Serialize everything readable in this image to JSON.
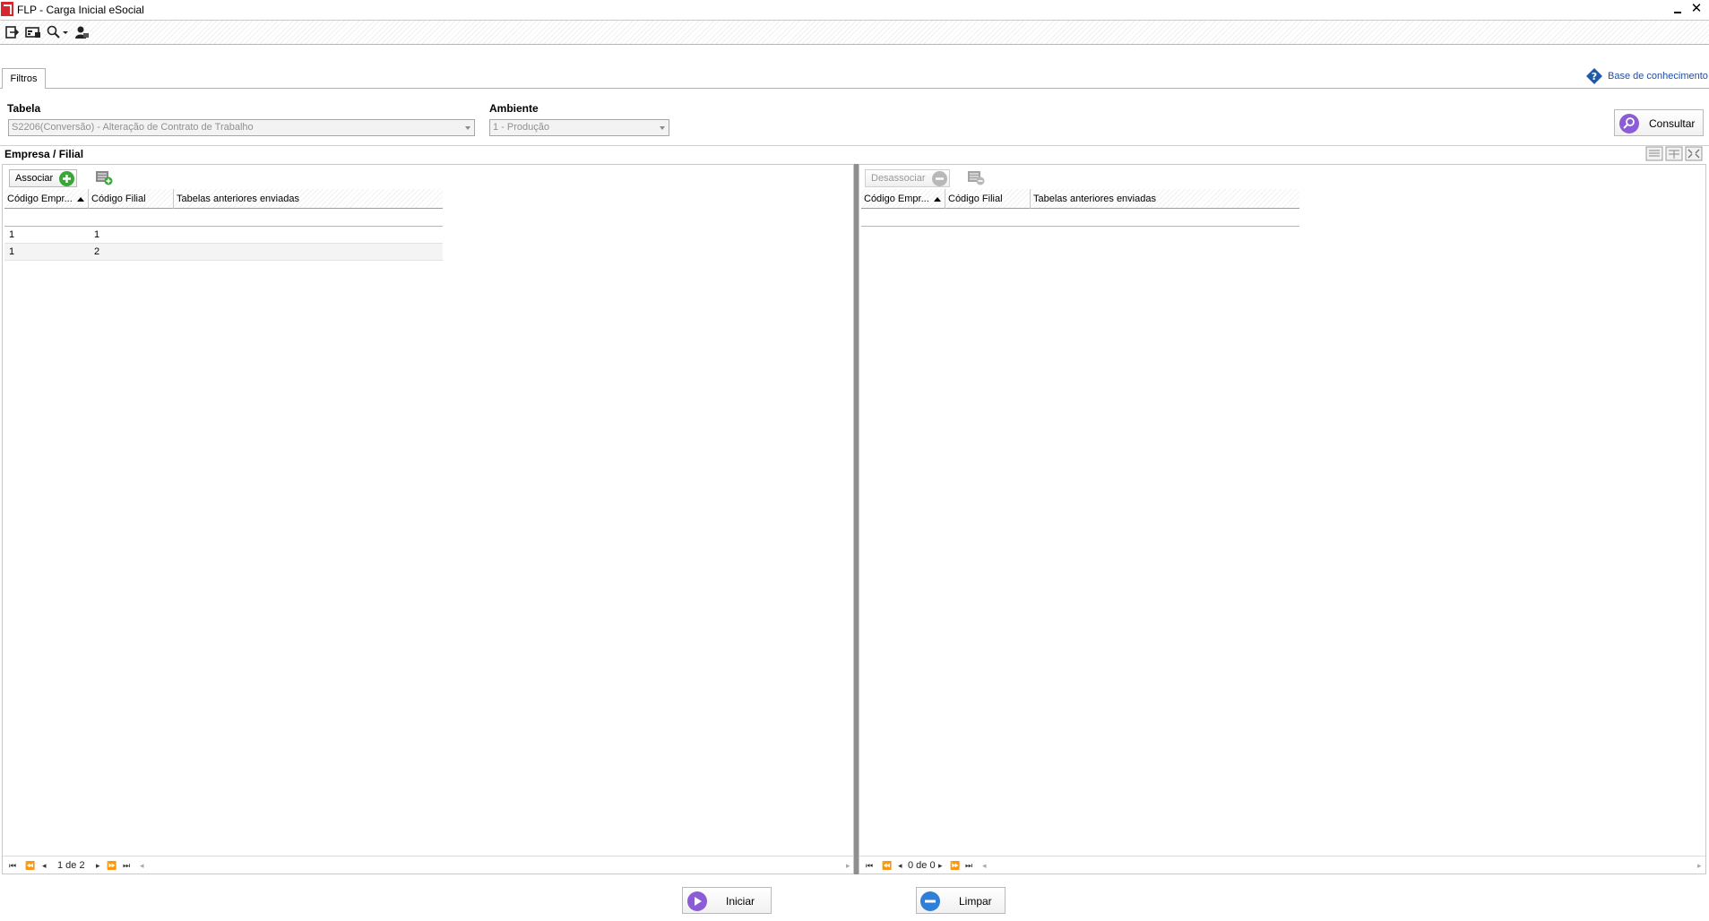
{
  "window": {
    "title": "FLP - Carga Inicial eSocial"
  },
  "toolbar": {
    "icons": [
      "exit-icon",
      "card-icon",
      "search-icon",
      "user-icon"
    ]
  },
  "tabs": [
    {
      "label": "Filtros"
    }
  ],
  "knowledge_base": {
    "label": "Base de conhecimento"
  },
  "filters": {
    "tabela_label": "Tabela",
    "tabela_value": "S2206(Conversão) - Alteração de Contrato de Trabalho",
    "ambiente_label": "Ambiente",
    "ambiente_value": "1 - Produção",
    "consultar_label": "Consultar"
  },
  "group": {
    "title": "Empresa / Filial"
  },
  "left_panel": {
    "action_label": "Associar",
    "columns": [
      "Código Empr...",
      "Código Filial",
      "Tabelas anteriores enviadas"
    ],
    "rows": [
      {
        "empresa": "1",
        "filial": "1",
        "tabelas": ""
      },
      {
        "empresa": "1",
        "filial": "2",
        "tabelas": ""
      }
    ],
    "pager_text": "1 de 2"
  },
  "right_panel": {
    "action_label": "Desassociar",
    "columns": [
      "Código Empr...",
      "Código Filial",
      "Tabelas anteriores enviadas"
    ],
    "rows": [],
    "pager_text": "0 de 0"
  },
  "footer": {
    "iniciar_label": "Iniciar",
    "limpar_label": "Limpar"
  },
  "colors": {
    "accent_purple": "#8b5cd6",
    "accent_blue": "#2f7fd8",
    "link_blue": "#1f4fa5",
    "app_red": "#d7262e"
  }
}
